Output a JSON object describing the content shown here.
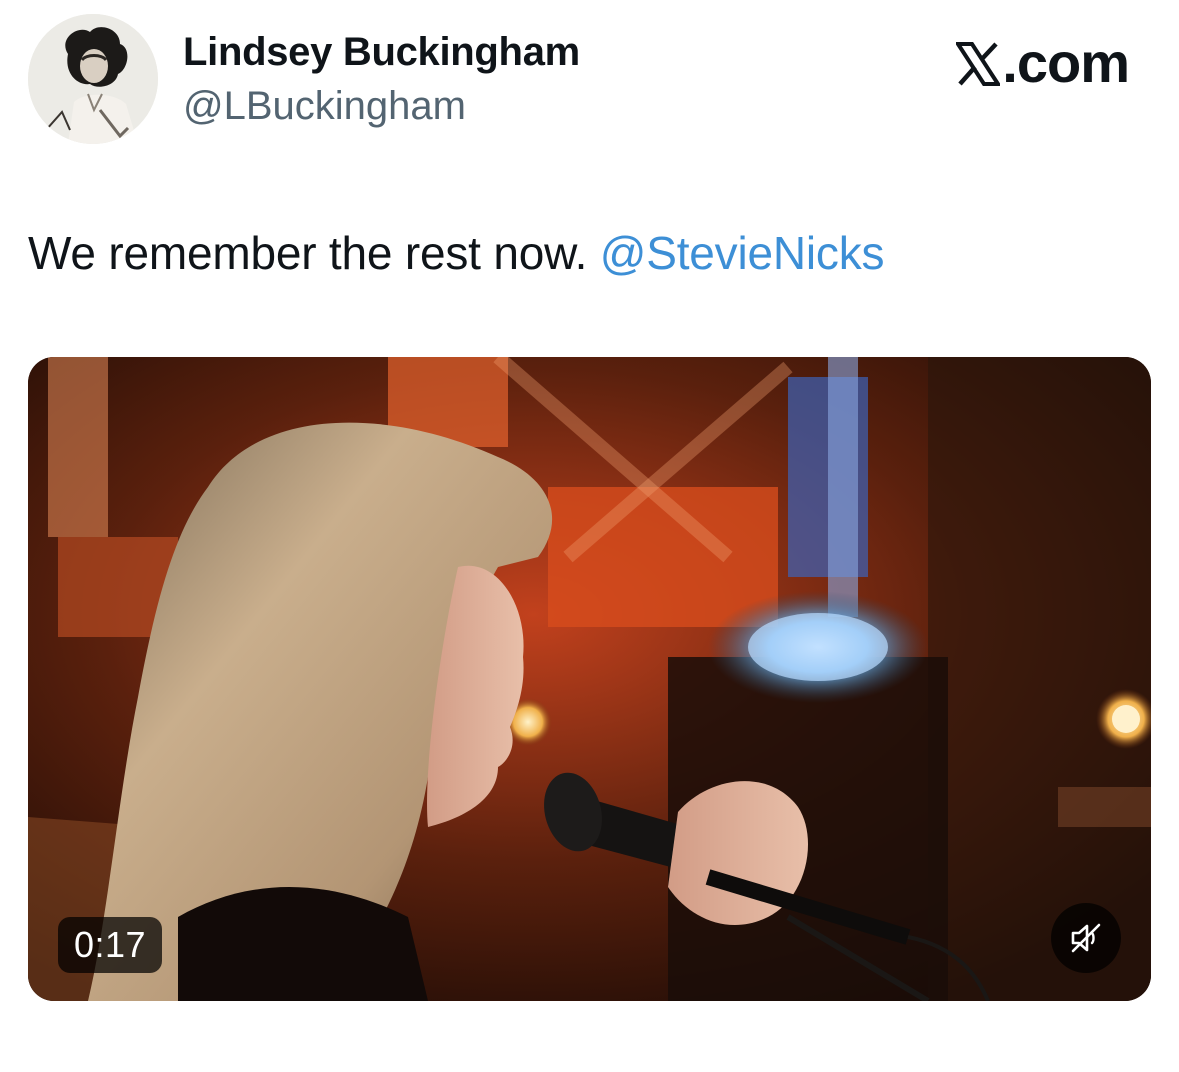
{
  "author": {
    "name": "Lindsey Buckingham",
    "handle": "@LBuckingham"
  },
  "site_logo": {
    "text": ".com",
    "icon": "x-logo-icon"
  },
  "tweet": {
    "text": "We remember the rest now. ",
    "mention": "@StevieNicks"
  },
  "media": {
    "type": "video",
    "duration": "0:17",
    "muted": true,
    "mute_icon": "speaker-muted-icon"
  },
  "colors": {
    "mention": "#3d8fd6",
    "handle": "#536471",
    "text": "#0f1419"
  }
}
